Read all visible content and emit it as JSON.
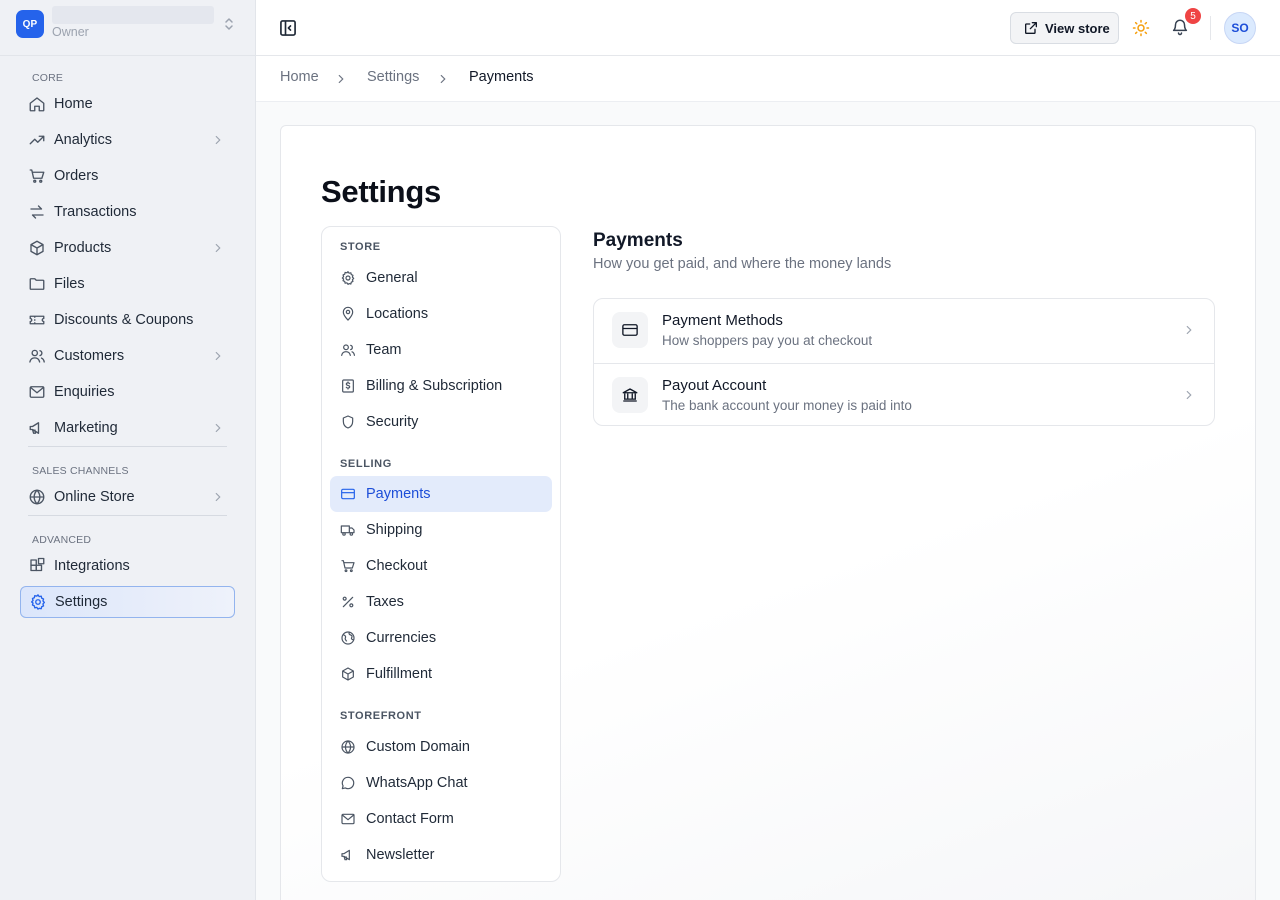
{
  "store": {
    "logo_initials": "QP",
    "role": "Owner"
  },
  "sidebar": {
    "sections": {
      "core": "CORE",
      "sales_channels": "SALES CHANNELS",
      "advanced": "ADVANCED"
    },
    "items": [
      {
        "label": "Home",
        "icon": "home-icon"
      },
      {
        "label": "Analytics",
        "icon": "trending-up-icon",
        "has_chevron": true
      },
      {
        "label": "Orders",
        "icon": "cart-icon"
      },
      {
        "label": "Transactions",
        "icon": "arrows-swap-icon"
      },
      {
        "label": "Products",
        "icon": "package-icon",
        "has_chevron": true
      },
      {
        "label": "Files",
        "icon": "folder-icon"
      },
      {
        "label": "Discounts & Coupons",
        "icon": "ticket-icon"
      },
      {
        "label": "Customers",
        "icon": "users-icon",
        "has_chevron": true
      },
      {
        "label": "Enquiries",
        "icon": "mail-icon"
      },
      {
        "label": "Marketing",
        "icon": "megaphone-icon",
        "has_chevron": true
      },
      {
        "label": "Online Store",
        "icon": "globe-icon",
        "has_chevron": true
      },
      {
        "label": "Integrations",
        "icon": "blocks-icon"
      },
      {
        "label": "Settings",
        "icon": "gear-icon",
        "active": true
      }
    ]
  },
  "topbar": {
    "view_store_label": "View store",
    "notification_count": "5",
    "avatar_initials": "SO"
  },
  "breadcrumb": [
    "Home",
    "Settings",
    "Payments"
  ],
  "page": {
    "title": "Settings"
  },
  "settings_nav": {
    "sections": {
      "store": "STORE",
      "selling": "SELLING",
      "storefront": "STOREFRONT"
    },
    "items": [
      {
        "label": "General",
        "icon": "gear-icon"
      },
      {
        "label": "Locations",
        "icon": "map-pin-icon"
      },
      {
        "label": "Team",
        "icon": "users-icon"
      },
      {
        "label": "Billing & Subscription",
        "icon": "receipt-icon"
      },
      {
        "label": "Security",
        "icon": "shield-icon"
      },
      {
        "label": "Payments",
        "icon": "credit-card-icon",
        "active": true
      },
      {
        "label": "Shipping",
        "icon": "truck-icon"
      },
      {
        "label": "Checkout",
        "icon": "cart-icon"
      },
      {
        "label": "Taxes",
        "icon": "percent-icon"
      },
      {
        "label": "Currencies",
        "icon": "globe-icon"
      },
      {
        "label": "Fulfillment",
        "icon": "package-icon"
      },
      {
        "label": "Custom Domain",
        "icon": "globe-icon"
      },
      {
        "label": "WhatsApp Chat",
        "icon": "chat-icon"
      },
      {
        "label": "Contact Form",
        "icon": "mail-icon"
      },
      {
        "label": "Newsletter",
        "icon": "megaphone-icon"
      }
    ]
  },
  "panel": {
    "title": "Payments",
    "subtitle": "How you get paid, and where the money lands",
    "options": [
      {
        "title": "Payment Methods",
        "description": "How shoppers pay you at checkout",
        "icon": "credit-card-icon"
      },
      {
        "title": "Payout Account",
        "description": "The bank account your money is paid into",
        "icon": "bank-icon"
      }
    ]
  },
  "colors": {
    "accent": "#2563eb",
    "badge": "#ef4444",
    "sun": "#f59e0b"
  }
}
